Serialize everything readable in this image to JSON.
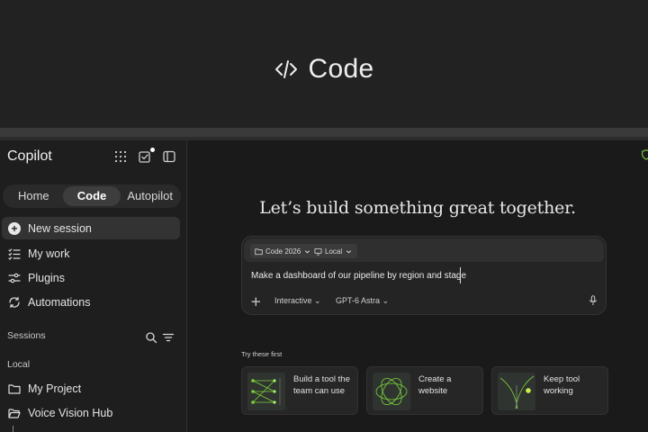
{
  "banner": {
    "title": "Code",
    "icon": "code-brackets-icon"
  },
  "sidebar": {
    "app_title": "Copilot",
    "top_icons": [
      "grid-icon",
      "tasks-check-icon",
      "sidebar-toggle-icon"
    ],
    "mode_tabs": [
      {
        "label": "Home",
        "active": false
      },
      {
        "label": "Code",
        "active": true
      },
      {
        "label": "Autopilot",
        "active": false
      }
    ],
    "nav_items": [
      {
        "label": "New session",
        "icon": "plus-circle-icon",
        "active": true
      },
      {
        "label": "My work",
        "icon": "checklist-icon",
        "active": false
      },
      {
        "label": "Plugins",
        "icon": "sliders-icon",
        "active": false
      },
      {
        "label": "Automations",
        "icon": "loop-arrows-icon",
        "active": false
      }
    ],
    "sessions_label": "Sessions",
    "local_label": "Local",
    "folders": [
      {
        "label": "My Project",
        "icon": "folder-icon"
      },
      {
        "label": "Voice Vision Hub",
        "icon": "folder-open-icon"
      }
    ]
  },
  "main": {
    "headline": "Let’s build something great together.",
    "composer": {
      "project_chip": "Code 2026",
      "location_chip": "Local",
      "prompt": "Make a dashboard of our pipeline by region and stage",
      "mode": "Interactive",
      "model": "GPT-6 Astra"
    },
    "try_label": "Try these first",
    "cards": [
      {
        "text": "Build a tool the team can use"
      },
      {
        "text": "Create a website"
      },
      {
        "text": "Keep tool working"
      }
    ]
  },
  "colors": {
    "accent": "#7cd13a",
    "background": "#1b1b1b",
    "banner": "#222222"
  }
}
